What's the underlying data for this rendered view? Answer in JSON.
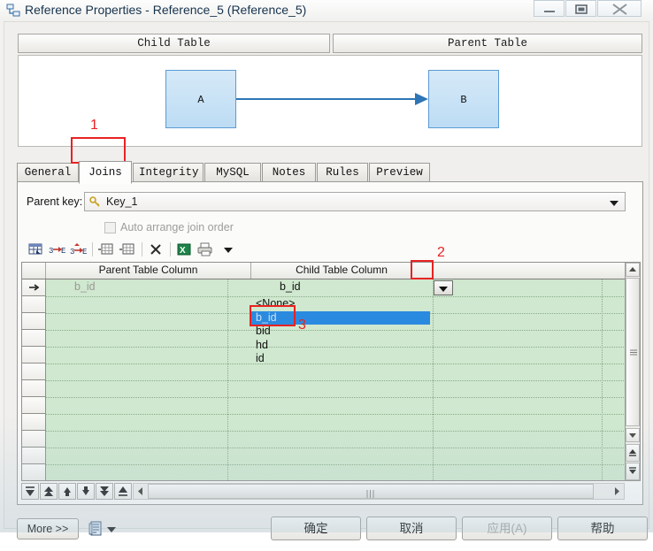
{
  "window": {
    "title": "Reference Properties - Reference_5 (Reference_5)",
    "icon": "reference-properties-icon",
    "controls": {
      "minimize": "minimize-icon",
      "maximize": "restore-icon",
      "close": "close-icon"
    }
  },
  "diagram": {
    "child_caption": "Child Table",
    "parent_caption": "Parent Table",
    "child_entity": "A",
    "parent_entity": "B",
    "relationship": "arrow-right-icon",
    "entity_fill": "#bcdcf4",
    "entity_border": "#5b9bd5",
    "arrow_color": "#2e75b6"
  },
  "tabs": [
    {
      "label": "General",
      "selected": false
    },
    {
      "label": "Joins",
      "selected": true
    },
    {
      "label": "Integrity",
      "selected": false
    },
    {
      "label": "MySQL",
      "selected": false
    },
    {
      "label": "Notes",
      "selected": false
    },
    {
      "label": "Rules",
      "selected": false
    },
    {
      "label": "Preview",
      "selected": false
    }
  ],
  "joins_panel": {
    "parent_key_label": "Parent key:",
    "parent_key_value": "Key_1",
    "parent_key_icon": "key-icon",
    "auto_arrange_label": "Auto arrange join order",
    "auto_arrange_checked": false,
    "auto_arrange_enabled": false,
    "toolbar": [
      {
        "name": "grid-properties-icon",
        "title": "Grid properties"
      },
      {
        "name": "insert-row-before-icon",
        "title": "Insert join"
      },
      {
        "name": "insert-row-after-icon",
        "title": "Insert join after"
      },
      {
        "name": "add-record-icon",
        "title": "Add record"
      },
      {
        "name": "duplicate-record-icon",
        "title": "Duplicate record"
      },
      {
        "name": "delete-icon",
        "title": "Delete"
      },
      {
        "name": "excel-export-icon",
        "title": "Export to Excel"
      },
      {
        "name": "print-icon",
        "title": "Print"
      },
      {
        "name": "dropdown-caret-icon",
        "title": "More"
      }
    ],
    "grid": {
      "columns": [
        "Parent Table Column",
        "Child Table Column"
      ],
      "rows": [
        {
          "marker": "current-row-arrow-icon",
          "parent_column": "b_id",
          "child_column": "b_id"
        }
      ],
      "empty_rows": 11,
      "background_color": "#cfe8cf"
    },
    "dropdown": {
      "open": true,
      "items": [
        "<None>",
        "b_id",
        "bid",
        "hd",
        "id"
      ],
      "selected_index": 1,
      "highlight_color": "#2a8ae0"
    },
    "row_nav": [
      {
        "name": "first-record-button"
      },
      {
        "name": "previous-page-button"
      },
      {
        "name": "previous-record-button"
      },
      {
        "name": "next-record-button"
      },
      {
        "name": "next-page-button"
      },
      {
        "name": "last-record-button"
      }
    ],
    "scrollbars": {
      "vertical": "vertical-scrollbar",
      "horizontal": "horizontal-scrollbar"
    }
  },
  "footer": {
    "more_label": "More >>",
    "script_icon": "script-icon",
    "ok_label": "确定",
    "cancel_label": "取消",
    "apply_label": "应用(A)",
    "apply_enabled": false,
    "help_label": "帮助"
  },
  "annotations": [
    {
      "number": "1",
      "target": "joins-tab"
    },
    {
      "number": "2",
      "target": "child-column-dropdown-button"
    },
    {
      "number": "3",
      "target": "dropdown-item-bid"
    }
  ],
  "colors": {
    "annotation": "#e82222",
    "grid_green": "#cfe8cf",
    "selection_blue": "#2a8ae0"
  }
}
